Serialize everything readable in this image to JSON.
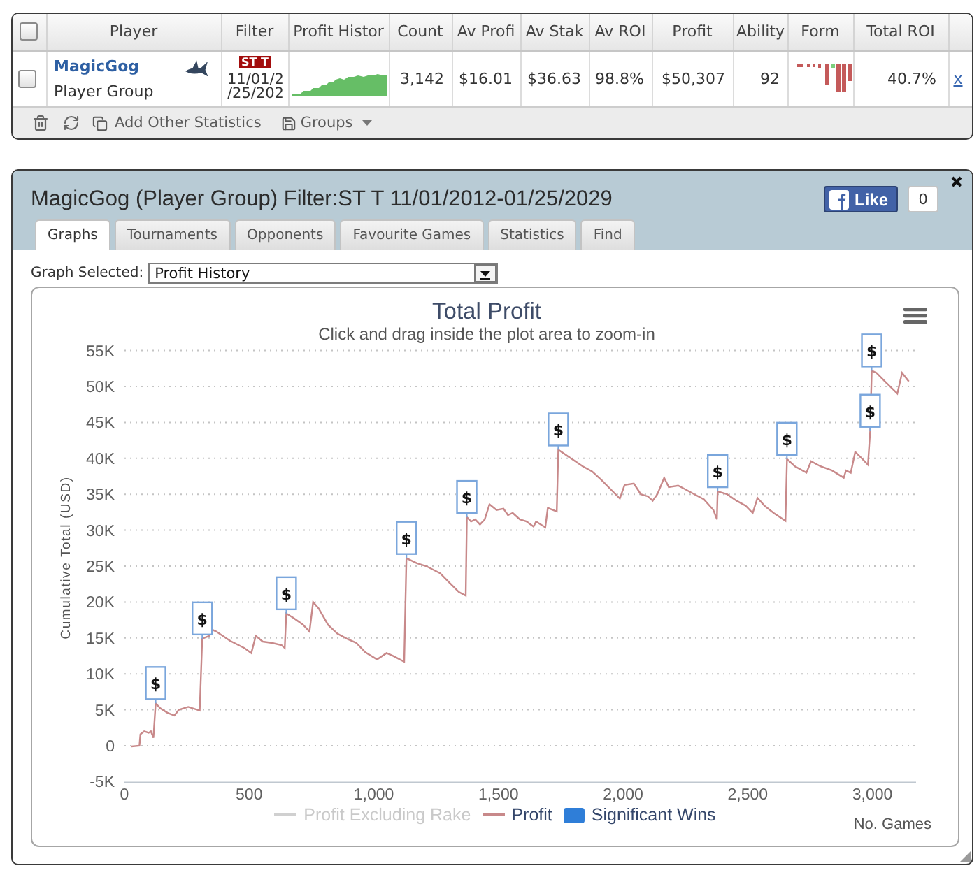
{
  "players_table": {
    "select_all": {
      "checked": false
    },
    "columns": [
      {
        "kind": "player",
        "label": "Player"
      },
      {
        "kind": "filter",
        "label": "Filter"
      },
      {
        "kind": "sparkline",
        "label": "Profit Histor"
      },
      {
        "kind": "count",
        "label": "Count"
      },
      {
        "kind": "av_profit",
        "label": "Av Profi"
      },
      {
        "kind": "av_stake",
        "label": "Av Stak"
      },
      {
        "kind": "av_roi",
        "label": "Av ROI"
      },
      {
        "kind": "profit",
        "label": "Profit"
      },
      {
        "kind": "ability",
        "label": "Ability"
      },
      {
        "kind": "form",
        "label": "Form"
      },
      {
        "kind": "total_roi",
        "label": "Total ROI"
      }
    ],
    "rows": [
      {
        "checked": false,
        "player": "MagicGog",
        "group": "Player Group",
        "filter_tag": "ST T",
        "filter_dates": [
          "11/01/2",
          "/25/202"
        ],
        "count": "3,142",
        "av_profit": "$16.01",
        "av_stake": "$36.63",
        "av_roi": "98.8%",
        "profit": "$50,307",
        "ability": "92",
        "total_roi": "40.7%",
        "remove": "x"
      }
    ],
    "toolbar": {
      "add_statistics": "Add Other Statistics",
      "groups": "Groups"
    }
  },
  "player_panel": {
    "title": "MagicGog (Player Group) Filter:ST T 11/01/2012-01/25/2029",
    "like": {
      "label": "Like",
      "count": "0"
    },
    "tabs": [
      {
        "label": "Graphs",
        "selected": true
      },
      {
        "label": "Tournaments",
        "selected": false
      },
      {
        "label": "Opponents",
        "selected": false
      },
      {
        "label": "Favourite Games",
        "selected": false
      },
      {
        "label": "Statistics",
        "selected": false
      },
      {
        "label": "Find",
        "selected": false
      }
    ],
    "graph_select": {
      "label": "Graph Selected:",
      "value": "Profit History"
    },
    "graph": {
      "subtitle": "Click and drag inside the plot area to zoom-in",
      "legend": [
        {
          "kind": "hidden",
          "label": "Profit Excluding Rake"
        },
        {
          "kind": "series"
        },
        {
          "kind": "flags",
          "label": "Significant Wins"
        }
      ],
      "chart_data": {
        "type": "line",
        "title": "Total Profit",
        "xlabel": "No. Games",
        "ylabel": "Cumulative Total (USD)",
        "grid": true,
        "x": [
          28,
          60,
          64,
          79,
          97,
          106,
          116,
          125,
          144,
          172,
          200,
          218,
          256,
          275,
          302,
          312,
          340,
          349,
          368,
          424,
          481,
          509,
          527,
          555,
          593,
          630,
          643,
          649,
          677,
          714,
          742,
          757,
          779,
          817,
          854,
          892,
          930,
          966,
          1013,
          1051,
          1078,
          1122,
          1131,
          1173,
          1210,
          1266,
          1303,
          1341,
          1369,
          1373,
          1390,
          1407,
          1426,
          1445,
          1464,
          1492,
          1520,
          1538,
          1557,
          1586,
          1613,
          1641,
          1651,
          1670,
          1688,
          1698,
          1734,
          1740,
          1782,
          1838,
          1875,
          1913,
          1950,
          1987,
          2006,
          2043,
          2071,
          2099,
          2119,
          2137,
          2165,
          2183,
          2221,
          2249,
          2286,
          2324,
          2362,
          2376,
          2379,
          2417,
          2455,
          2492,
          2520,
          2539,
          2567,
          2604,
          2651,
          2657,
          2689,
          2735,
          2754,
          2792,
          2838,
          2885,
          2894,
          2913,
          2931,
          2960,
          2982,
          2991,
          2997,
          3016,
          3053,
          3100,
          3119,
          3146
        ],
        "series": [
          {
            "name": "Profit",
            "color": "#c8898a",
            "values": [
              -100,
              0,
              1600,
              2000,
              1800,
              2000,
              1100,
              5900,
              5200,
              4600,
              4200,
              5000,
              5400,
              5200,
              4900,
              14900,
              15300,
              16200,
              15900,
              14600,
              13600,
              12900,
              15300,
              14500,
              14300,
              14000,
              13600,
              18400,
              17800,
              16900,
              15900,
              20000,
              19100,
              16800,
              15600,
              14900,
              14300,
              13000,
              12000,
              12900,
              12500,
              11700,
              26100,
              25400,
              25000,
              24000,
              22700,
              21400,
              20900,
              31800,
              31200,
              31500,
              30800,
              31500,
              33600,
              32800,
              33000,
              32100,
              32400,
              31500,
              31200,
              30500,
              31200,
              30800,
              30400,
              33100,
              32600,
              41200,
              40200,
              38900,
              38200,
              37000,
              35700,
              34400,
              36300,
              36500,
              35000,
              34700,
              34100,
              35000,
              37300,
              36000,
              36200,
              35700,
              35000,
              34300,
              32800,
              31500,
              35400,
              35000,
              34100,
              33400,
              32400,
              34500,
              33400,
              32400,
              31300,
              39900,
              38900,
              38000,
              39600,
              38900,
              38300,
              37300,
              38300,
              38000,
              40900,
              39900,
              39100,
              43800,
              52200,
              51900,
              50600,
              49000,
              51900,
              50700
            ]
          }
        ],
        "xlim": [
          0,
          3175
        ],
        "ylim": [
          -5000,
          55000
        ],
        "xticks": [
          0,
          500,
          {
            "value": 1000,
            "label": "1,000"
          },
          {
            "value": 1500,
            "label": "1,500"
          },
          {
            "value": 2000,
            "label": "2,000"
          },
          {
            "value": 2500,
            "label": "2,500"
          },
          {
            "value": 3000,
            "label": "3,000"
          }
        ],
        "yticks": [
          {
            "value": -5000,
            "label": "-5K"
          },
          0,
          {
            "value": 5000,
            "label": "5K"
          },
          {
            "value": 10000,
            "label": "10K"
          },
          {
            "value": 15000,
            "label": "15K"
          },
          {
            "value": 20000,
            "label": "20K"
          },
          {
            "value": 25000,
            "label": "25K"
          },
          {
            "value": 30000,
            "label": "30K"
          },
          {
            "value": 35000,
            "label": "35K"
          },
          {
            "value": 40000,
            "label": "40K"
          },
          {
            "value": 45000,
            "label": "45K"
          },
          {
            "value": 50000,
            "label": "50K"
          },
          {
            "value": 55000,
            "label": "55K"
          }
        ],
        "annotations": [
          {
            "x": 125,
            "y": 5900,
            "text": "$"
          },
          {
            "x": 312,
            "y": 14900,
            "text": "$"
          },
          {
            "x": 649,
            "y": 18400,
            "text": "$"
          },
          {
            "x": 1131,
            "y": 26100,
            "text": "$"
          },
          {
            "x": 1373,
            "y": 31800,
            "text": "$"
          },
          {
            "x": 1740,
            "y": 41200,
            "text": "$"
          },
          {
            "x": 2379,
            "y": 35400,
            "text": "$"
          },
          {
            "x": 2657,
            "y": 39900,
            "text": "$"
          },
          {
            "x": 2991,
            "y": 43800,
            "text": "$"
          },
          {
            "x": 2997,
            "y": 52200,
            "text": "$"
          }
        ]
      }
    }
  }
}
